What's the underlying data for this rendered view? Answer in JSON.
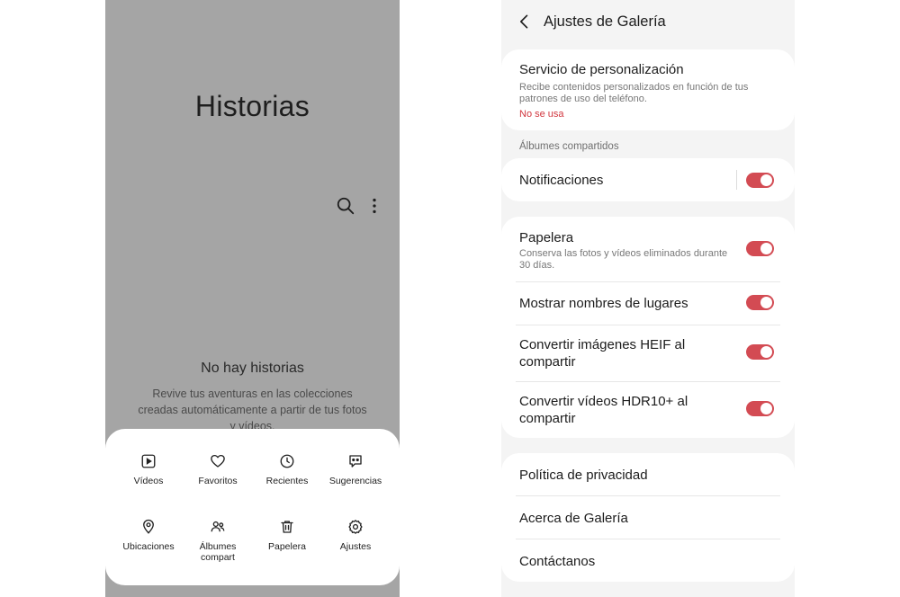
{
  "gallery": {
    "title": "Historias",
    "icons": {
      "search": "search-icon",
      "more": "more-vertical-icon"
    },
    "empty_title": "No hay historias",
    "empty_description": "Revive tus aventuras en las colecciones creadas automáticamente a partir de tus fotos y vídeos.",
    "menu": [
      {
        "label": "Vídeos",
        "icon": "video-icon"
      },
      {
        "label": "Favoritos",
        "icon": "heart-icon"
      },
      {
        "label": "Recientes",
        "icon": "clock-icon"
      },
      {
        "label": "Sugerencias",
        "icon": "suggestions-icon"
      },
      {
        "label": "Ubicaciones",
        "icon": "location-icon"
      },
      {
        "label": "Álbumes compart",
        "icon": "shared-albums-icon"
      },
      {
        "label": "Papelera",
        "icon": "trash-icon"
      },
      {
        "label": "Ajustes",
        "icon": "gear-icon"
      }
    ]
  },
  "settings": {
    "title": "Ajustes de Galería",
    "personalization": {
      "title": "Servicio de personalización",
      "description": "Recibe contenidos personalizados en función de tus patrones de uso del teléfono.",
      "status": "No se usa"
    },
    "shared_albums_header": "Álbumes compartidos",
    "notifications": {
      "label": "Notificaciones",
      "enabled": true
    },
    "trash": {
      "label": "Papelera",
      "description": "Conserva las fotos y vídeos eliminados durante 30 días.",
      "enabled": true
    },
    "place_names": {
      "label": "Mostrar nombres de lugares",
      "enabled": true
    },
    "heif": {
      "label": "Convertir imágenes HEIF al compartir",
      "enabled": true
    },
    "hdr": {
      "label": "Convertir vídeos HDR10+ al compartir",
      "enabled": true
    },
    "links": {
      "privacy": "Política de privacidad",
      "about": "Acerca de Galería",
      "contact": "Contáctanos"
    }
  },
  "colors": {
    "toggle_on": "#d34b53",
    "warning_text": "#d1363e",
    "gallery_background": "#a5a5a5",
    "settings_background": "#f4f4f4"
  }
}
